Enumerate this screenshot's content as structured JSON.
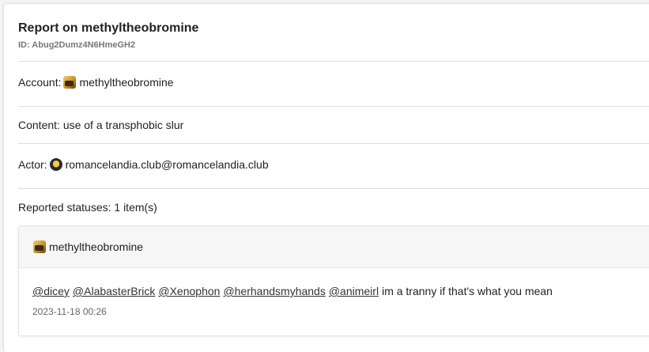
{
  "report": {
    "title": "Report on methyltheobromine",
    "id_label": "ID: Abug2Dumz4N6HmeGH2"
  },
  "account": {
    "label": "Account:",
    "name": "methyltheobromine"
  },
  "content": {
    "text": "Content: use of a transphobic slur"
  },
  "actor": {
    "label": "Actor:",
    "name": "romancelandia.club@romancelandia.club"
  },
  "reported_statuses": {
    "label": "Reported statuses: 1 item(s)"
  },
  "status": {
    "author": "methyltheobromine",
    "mentions": [
      "@dicey",
      "@AlabasterBrick",
      "@Xenophon",
      "@herhandsmyhands",
      "@animeirl"
    ],
    "text": "im a tranny if that's what you mean",
    "timestamp": "2023-11-18 00:26"
  }
}
